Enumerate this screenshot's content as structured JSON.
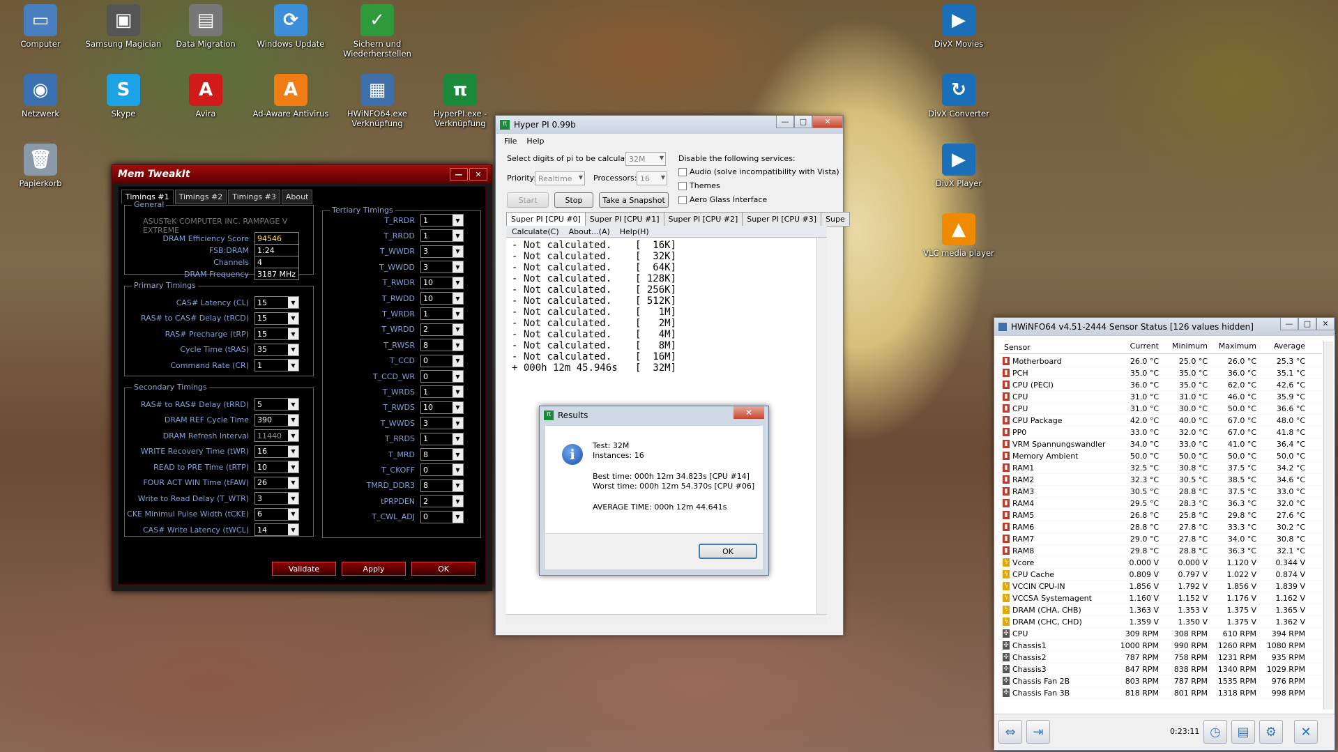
{
  "desktop_icons": [
    {
      "label": "Computer",
      "icon": "computer-icon",
      "color": "#4a7fbf",
      "glyph": "▭"
    },
    {
      "label": "Samsung Magician",
      "icon": "samsung-magician-icon",
      "color": "#555",
      "glyph": "▣"
    },
    {
      "label": "Data Migration",
      "icon": "data-migration-icon",
      "color": "#777",
      "glyph": "▤"
    },
    {
      "label": "Windows Update",
      "icon": "windows-update-icon",
      "color": "#3c8fd8",
      "glyph": "⟳"
    },
    {
      "label": "Sichern und Wiederherstellen",
      "icon": "backup-icon",
      "color": "#2f9a3c",
      "glyph": "✓"
    },
    {
      "label": "Netzwerk",
      "icon": "network-icon",
      "color": "#3a6fb0",
      "glyph": "◉"
    },
    {
      "label": "Skype",
      "icon": "skype-icon",
      "color": "#1ba3e6",
      "glyph": "S"
    },
    {
      "label": "Avira",
      "icon": "avira-icon",
      "color": "#d11a1a",
      "glyph": "A"
    },
    {
      "label": "Ad-Aware Antivirus",
      "icon": "ad-aware-icon",
      "color": "#ef7d13",
      "glyph": "A"
    },
    {
      "label": "HWiNFO64.exe Verknüpfung",
      "icon": "hwinfo-icon",
      "color": "#3e6fa8",
      "glyph": "▦"
    },
    {
      "label": "HyperPI.exe - Verknüpfung",
      "icon": "hyperpi-icon",
      "color": "#1a8a3a",
      "glyph": "π"
    },
    {
      "label": "Papierkorb",
      "icon": "recycle-bin-icon",
      "color": "#8a9aa8",
      "glyph": "🗑"
    },
    {
      "label": "DivX Movies",
      "icon": "divx-movies-icon",
      "color": "#1a6fb8",
      "glyph": "▶"
    },
    {
      "label": "DivX Converter",
      "icon": "divx-converter-icon",
      "color": "#1a6fb8",
      "glyph": "↻"
    },
    {
      "label": "DivX Player",
      "icon": "divx-player-icon",
      "color": "#1a6fb8",
      "glyph": "▶"
    },
    {
      "label": "VLC media player",
      "icon": "vlc-icon",
      "color": "#f08a00",
      "glyph": "▲"
    }
  ],
  "memtweakit": {
    "title": "Mem TweakIt",
    "tabs": [
      "Timings #1",
      "Timings #2",
      "Timings #3",
      "About"
    ],
    "general": {
      "title": "General",
      "board": "ASUSTeK COMPUTER INC. RAMPAGE V EXTREME",
      "rows": [
        {
          "label": "DRAM Efficiency Score",
          "value": "94546"
        },
        {
          "label": "FSB:DRAM",
          "value": "1:24"
        },
        {
          "label": "Channels",
          "value": "4"
        },
        {
          "label": "DRAM Frequency",
          "value": "3187 MHz"
        }
      ]
    },
    "primary": {
      "title": "Primary Timings",
      "rows": [
        {
          "label": "CAS# Latency (CL)",
          "value": "15"
        },
        {
          "label": "RAS# to CAS# Delay (tRCD)",
          "value": "15"
        },
        {
          "label": "RAS# Precharge (tRP)",
          "value": "15"
        },
        {
          "label": "Cycle Time (tRAS)",
          "value": "35"
        },
        {
          "label": "Command Rate (CR)",
          "value": "1"
        }
      ]
    },
    "secondary": {
      "title": "Secondary Timings",
      "rows": [
        {
          "label": "RAS# to RAS# Delay (tRRD)",
          "value": "5"
        },
        {
          "label": "DRAM REF Cycle Time",
          "value": "390"
        },
        {
          "label": "DRAM Refresh Interval",
          "value": "11440"
        },
        {
          "label": "WRITE Recovery Time (tWR)",
          "value": "16"
        },
        {
          "label": "READ to PRE Time (tRTP)",
          "value": "10"
        },
        {
          "label": "FOUR ACT WIN Time (tFAW)",
          "value": "26"
        },
        {
          "label": "Write to Read Delay (T_WTR)",
          "value": "3"
        },
        {
          "label": "CKE Minimul Pulse Width (tCKE)",
          "value": "6"
        },
        {
          "label": "CAS# Write Latency (tWCL)",
          "value": "14"
        }
      ]
    },
    "tertiary": {
      "title": "Tertiary Timings",
      "rows": [
        {
          "label": "T_RRDR",
          "value": "1"
        },
        {
          "label": "T_RRDD",
          "value": "1"
        },
        {
          "label": "T_WWDR",
          "value": "3"
        },
        {
          "label": "T_WWDD",
          "value": "3"
        },
        {
          "label": "T_RWDR",
          "value": "10"
        },
        {
          "label": "T_RWDD",
          "value": "10"
        },
        {
          "label": "T_WRDR",
          "value": "1"
        },
        {
          "label": "T_WRDD",
          "value": "2"
        },
        {
          "label": "T_RWSR",
          "value": "8"
        },
        {
          "label": "T_CCD",
          "value": "0"
        },
        {
          "label": "T_CCD_WR",
          "value": "0"
        },
        {
          "label": "T_WRDS",
          "value": "1"
        },
        {
          "label": "T_RWDS",
          "value": "10"
        },
        {
          "label": "T_WWDS",
          "value": "3"
        },
        {
          "label": "T_RRDS",
          "value": "1"
        },
        {
          "label": "T_MRD",
          "value": "8"
        },
        {
          "label": "T_CKOFF",
          "value": "0"
        },
        {
          "label": "TMRD_DDR3",
          "value": "8"
        },
        {
          "label": "tPRPDEN",
          "value": "2"
        },
        {
          "label": "T_CWL_ADJ",
          "value": "0"
        }
      ]
    },
    "buttons": {
      "validate": "Validate",
      "apply": "Apply",
      "ok": "OK"
    }
  },
  "hyperpi": {
    "title": "Hyper PI 0.99b",
    "menu": [
      "File",
      "Help"
    ],
    "digits_label": "Select digits of pi to be calculated:",
    "digits_value": "32M",
    "priority_label": "Priority:",
    "priority_value": "Realtime",
    "processors_label": "Processors:",
    "processors_value": "16",
    "disable_label": "Disable the following services:",
    "services": [
      "Audio (solve incompatibility with Vista)",
      "Themes",
      "Aero Glass Interface"
    ],
    "btn_start": "Start",
    "btn_stop": "Stop",
    "btn_snapshot": "Take a Snapshot",
    "cpu_tabs": [
      "Super PI [CPU #0]",
      "Super PI [CPU #1]",
      "Super PI [CPU #2]",
      "Super PI [CPU #3]",
      "Supe"
    ],
    "inner_menu": [
      "Calculate(C)",
      "About...(A)",
      "Help(H)"
    ],
    "output": [
      "- Not calculated.    [  16K]",
      "- Not calculated.    [  32K]",
      "- Not calculated.    [  64K]",
      "- Not calculated.    [ 128K]",
      "- Not calculated.    [ 256K]",
      "- Not calculated.    [ 512K]",
      "- Not calculated.    [   1M]",
      "- Not calculated.    [   2M]",
      "- Not calculated.    [   4M]",
      "- Not calculated.    [   8M]",
      "- Not calculated.    [  16M]",
      "+ 000h 12m 45.946s   [  32M]"
    ]
  },
  "results": {
    "title": "Results",
    "test": "Test: 32M",
    "instances": "Instances: 16",
    "best": "Best time: 000h 12m 34.823s [CPU #14]",
    "worst": "Worst time: 000h 12m 54.370s [CPU #06]",
    "average": "AVERAGE TIME: 000h 12m 44.641s",
    "ok": "OK"
  },
  "hwinfo": {
    "title": "HWiNFO64 v4.51-2444 Sensor Status [126 values hidden]",
    "columns": [
      "Sensor",
      "Current",
      "Minimum",
      "Maximum",
      "Average"
    ],
    "rows": [
      [
        "t",
        "Motherboard",
        "26.0 °C",
        "25.0 °C",
        "26.0 °C",
        "25.3 °C"
      ],
      [
        "t",
        "PCH",
        "35.0 °C",
        "35.0 °C",
        "36.0 °C",
        "35.1 °C"
      ],
      [
        "t",
        "CPU (PECI)",
        "36.0 °C",
        "35.0 °C",
        "62.0 °C",
        "42.6 °C"
      ],
      [
        "t",
        "CPU",
        "31.0 °C",
        "31.0 °C",
        "46.0 °C",
        "35.9 °C"
      ],
      [
        "t",
        "CPU",
        "31.0 °C",
        "30.0 °C",
        "50.0 °C",
        "36.6 °C"
      ],
      [
        "t",
        "CPU Package",
        "42.0 °C",
        "40.0 °C",
        "67.0 °C",
        "48.0 °C"
      ],
      [
        "t",
        "PP0",
        "33.0 °C",
        "32.0 °C",
        "67.0 °C",
        "41.8 °C"
      ],
      [
        "t",
        "VRM Spannungswandler",
        "34.0 °C",
        "33.0 °C",
        "41.0 °C",
        "36.4 °C"
      ],
      [
        "t",
        "Memory Ambient",
        "50.0 °C",
        "50.0 °C",
        "50.0 °C",
        "50.0 °C"
      ],
      [
        "t",
        "RAM1",
        "32.5 °C",
        "30.8 °C",
        "37.5 °C",
        "34.2 °C"
      ],
      [
        "t",
        "RAM2",
        "32.3 °C",
        "30.5 °C",
        "38.5 °C",
        "34.6 °C"
      ],
      [
        "t",
        "RAM3",
        "30.5 °C",
        "28.8 °C",
        "37.5 °C",
        "33.0 °C"
      ],
      [
        "t",
        "RAM4",
        "29.5 °C",
        "28.3 °C",
        "36.3 °C",
        "32.0 °C"
      ],
      [
        "t",
        "RAM5",
        "26.8 °C",
        "25.8 °C",
        "29.8 °C",
        "27.6 °C"
      ],
      [
        "t",
        "RAM6",
        "28.8 °C",
        "27.8 °C",
        "33.3 °C",
        "30.2 °C"
      ],
      [
        "t",
        "RAM7",
        "29.0 °C",
        "27.8 °C",
        "34.0 °C",
        "30.8 °C"
      ],
      [
        "t",
        "RAM8",
        "29.8 °C",
        "28.8 °C",
        "36.3 °C",
        "32.1 °C"
      ],
      [
        "v",
        "Vcore",
        "0.000 V",
        "0.000 V",
        "1.120 V",
        "0.344 V"
      ],
      [
        "v",
        "CPU Cache",
        "0.809 V",
        "0.797 V",
        "1.022 V",
        "0.874 V"
      ],
      [
        "v",
        "VCCIN CPU-IN",
        "1.856 V",
        "1.792 V",
        "1.856 V",
        "1.839 V"
      ],
      [
        "v",
        "VCCSA Systemagent",
        "1.160 V",
        "1.152 V",
        "1.176 V",
        "1.162 V"
      ],
      [
        "v",
        "DRAM (CHA, CHB)",
        "1.363 V",
        "1.353 V",
        "1.375 V",
        "1.365 V"
      ],
      [
        "v",
        "DRAM (CHC, CHD)",
        "1.359 V",
        "1.350 V",
        "1.375 V",
        "1.362 V"
      ],
      [
        "f",
        "CPU",
        "309 RPM",
        "308 RPM",
        "610 RPM",
        "394 RPM"
      ],
      [
        "f",
        "Chassis1",
        "1000 RPM",
        "990 RPM",
        "1260 RPM",
        "1080 RPM"
      ],
      [
        "f",
        "Chassis2",
        "787 RPM",
        "758 RPM",
        "1231 RPM",
        "935 RPM"
      ],
      [
        "f",
        "Chassis3",
        "847 RPM",
        "838 RPM",
        "1340 RPM",
        "1029 RPM"
      ],
      [
        "f",
        "Chassis Fan 2B",
        "803 RPM",
        "787 RPM",
        "1535 RPM",
        "976 RPM"
      ],
      [
        "f",
        "Chassis Fan 3B",
        "818 RPM",
        "801 RPM",
        "1318 RPM",
        "998 RPM"
      ]
    ],
    "timer": "0:23:11"
  }
}
